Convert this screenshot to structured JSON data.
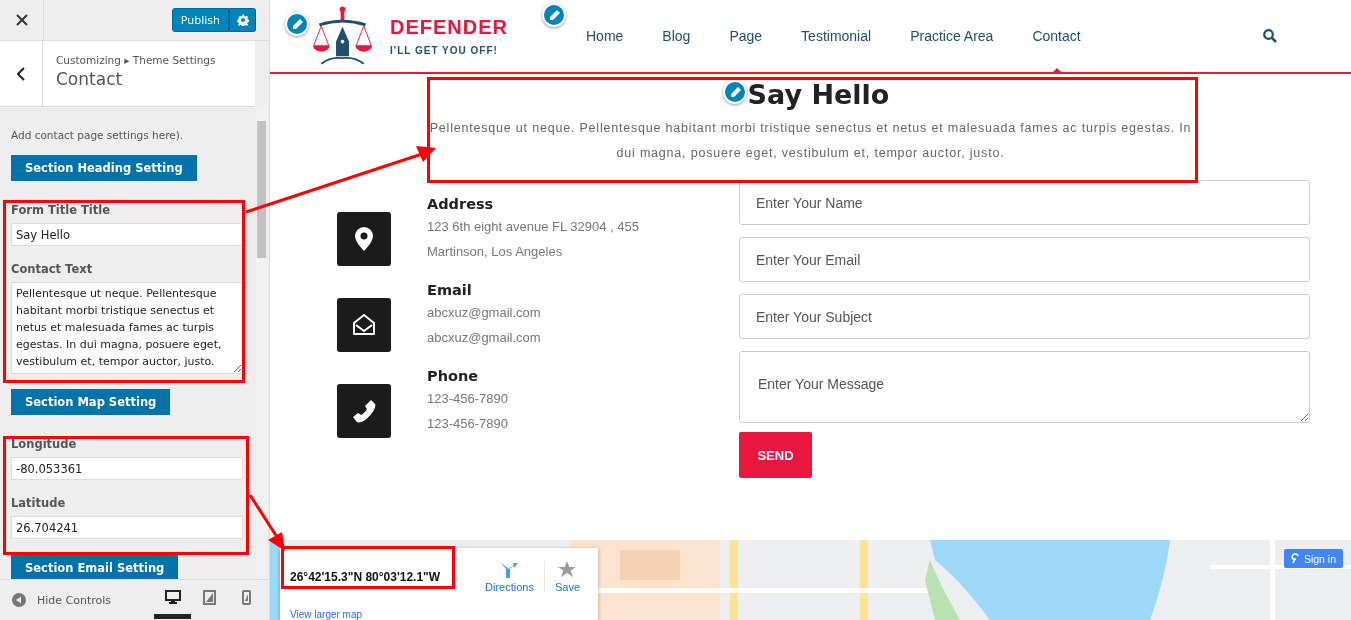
{
  "customizer": {
    "publish": "Publish",
    "breadcrumb": "Customizing ▸ Theme Settings",
    "title": "Contact",
    "description": "Add contact page settings here).",
    "controls": [
      {
        "kind": "section",
        "label": "Section Heading Setting"
      },
      {
        "kind": "text",
        "label": "Form Title Title",
        "value": "Say Hello"
      },
      {
        "kind": "textarea",
        "label": "Contact Text",
        "value": "Pellentesque ut neque. Pellentesque habitant morbi tristique senectus et netus et malesuada fames ac turpis egestas. In dui magna, posuere eget, vestibulum et, tempor auctor, justo."
      },
      {
        "kind": "section",
        "label": "Section Map Setting"
      },
      {
        "kind": "text",
        "label": "Longitude",
        "value": "-80.053361"
      },
      {
        "kind": "text",
        "label": "Latitude",
        "value": "26.704241"
      },
      {
        "kind": "section",
        "label": "Section Email Setting"
      }
    ],
    "footer": {
      "hide_controls": "Hide Controls",
      "devices": [
        {
          "kind": "desktop",
          "selected": true
        },
        {
          "kind": "tablet",
          "selected": false
        },
        {
          "kind": "mobile",
          "selected": false
        }
      ]
    }
  },
  "site": {
    "logo": {
      "name": "DEFENDER",
      "tagline": "I'LL GET YOU OFF!"
    },
    "nav": [
      {
        "label": "Home",
        "selected": false
      },
      {
        "label": "Blog",
        "selected": false
      },
      {
        "label": "Page",
        "selected": false
      },
      {
        "label": "Testimonial",
        "selected": false
      },
      {
        "label": "Practice Area",
        "selected": false
      },
      {
        "label": "Contact",
        "selected": true
      }
    ],
    "heading": "Say Hello",
    "intro": "Pellentesque ut neque. Pellentesque habitant morbi tristique senectus et netus et malesuada fames ac turpis egestas. In dui magna, posuere eget, vestibulum et, tempor auctor, justo.",
    "contact_items": [
      {
        "kind": "address",
        "title": "Address",
        "lines": [
          "123 6th eight avenue FL 32904 , 455",
          "Martinson, Los Angeles"
        ]
      },
      {
        "kind": "email",
        "title": "Email",
        "lines": [
          "abcxuz@gmail.com",
          "abcxuz@gmail.com"
        ]
      },
      {
        "kind": "phone",
        "title": "Phone",
        "lines": [
          "123-456-7890",
          "123-456-7890"
        ]
      }
    ],
    "form": {
      "fields": [
        {
          "kind": "input",
          "placeholder": "Enter Your Name"
        },
        {
          "kind": "input",
          "placeholder": "Enter Your Email"
        },
        {
          "kind": "input",
          "placeholder": "Enter Your Subject"
        },
        {
          "kind": "textarea",
          "placeholder": "Enter Your Message"
        }
      ],
      "button": "SEND"
    },
    "map": {
      "coordinates": "26°42'15.3\"N 80°03'12.1\"W",
      "directions": "Directions",
      "save": "Save",
      "view_larger": "View larger map",
      "sign_in": "Sign in"
    }
  }
}
